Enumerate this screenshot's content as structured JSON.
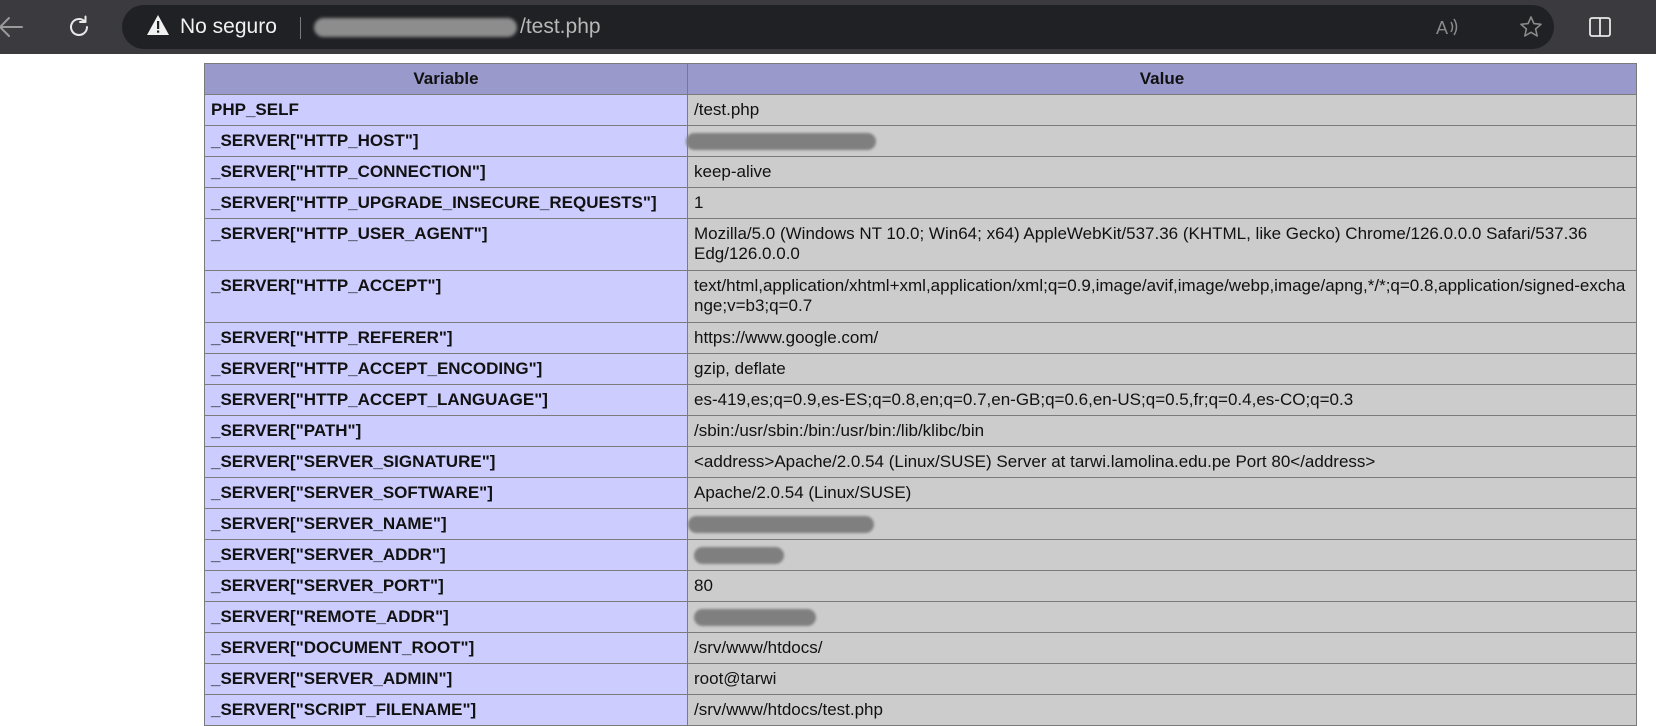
{
  "browser": {
    "security_label": "No seguro",
    "url_path": "/test.php"
  },
  "table": {
    "headers": [
      "Variable",
      "Value"
    ],
    "rows": [
      {
        "variable": "PHP_SELF",
        "value": "/test.php"
      },
      {
        "variable": "_SERVER[\"HTTP_HOST\"]",
        "value": ""
      },
      {
        "variable": "_SERVER[\"HTTP_CONNECTION\"]",
        "value": "keep-alive"
      },
      {
        "variable": "_SERVER[\"HTTP_UPGRADE_INSECURE_REQUESTS\"]",
        "value": "1"
      },
      {
        "variable": "_SERVER[\"HTTP_USER_AGENT\"]",
        "value": "Mozilla/5.0 (Windows NT 10.0; Win64; x64) AppleWebKit/537.36 (KHTML, like Gecko) Chrome/126.0.0.0 Safari/537.36 Edg/126.0.0.0"
      },
      {
        "variable": "_SERVER[\"HTTP_ACCEPT\"]",
        "value": "text/html,application/xhtml+xml,application/xml;q=0.9,image/avif,image/webp,image/apng,*/*;q=0.8,application/signed-exchange;v=b3;q=0.7"
      },
      {
        "variable": "_SERVER[\"HTTP_REFERER\"]",
        "value": "https://www.google.com/"
      },
      {
        "variable": "_SERVER[\"HTTP_ACCEPT_ENCODING\"]",
        "value": "gzip, deflate"
      },
      {
        "variable": "_SERVER[\"HTTP_ACCEPT_LANGUAGE\"]",
        "value": "es-419,es;q=0.9,es-ES;q=0.8,en;q=0.7,en-GB;q=0.6,en-US;q=0.5,fr;q=0.4,es-CO;q=0.3"
      },
      {
        "variable": "_SERVER[\"PATH\"]",
        "value": "/sbin:/usr/sbin:/bin:/usr/bin:/lib/klibc/bin"
      },
      {
        "variable": "_SERVER[\"SERVER_SIGNATURE\"]",
        "value": "<address>Apache/2.0.54 (Linux/SUSE) Server at tarwi.lamolina.edu.pe Port 80</address>"
      },
      {
        "variable": "_SERVER[\"SERVER_SOFTWARE\"]",
        "value": "Apache/2.0.54 (Linux/SUSE)"
      },
      {
        "variable": "_SERVER[\"SERVER_NAME\"]",
        "value": ""
      },
      {
        "variable": "_SERVER[\"SERVER_ADDR\"]",
        "value": ""
      },
      {
        "variable": "_SERVER[\"SERVER_PORT\"]",
        "value": "80"
      },
      {
        "variable": "_SERVER[\"REMOTE_ADDR\"]",
        "value": ""
      },
      {
        "variable": "_SERVER[\"DOCUMENT_ROOT\"]",
        "value": "/srv/www/htdocs/"
      },
      {
        "variable": "_SERVER[\"SERVER_ADMIN\"]",
        "value": "root@tarwi"
      },
      {
        "variable": "_SERVER[\"SCRIPT_FILENAME\"]",
        "value": "/srv/www/htdocs/test.php"
      }
    ]
  }
}
